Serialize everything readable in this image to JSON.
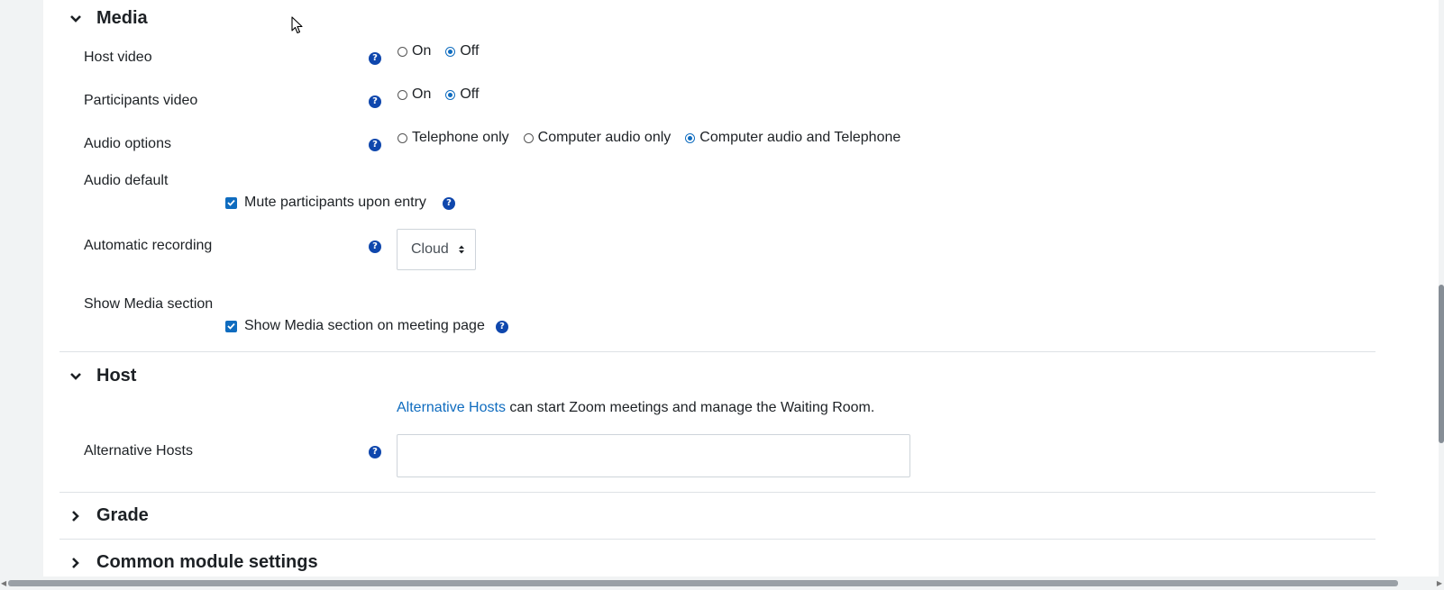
{
  "media": {
    "title": "Media",
    "host_video": {
      "label": "Host video",
      "options": [
        "On",
        "Off"
      ],
      "selected": "Off"
    },
    "participants_video": {
      "label": "Participants video",
      "options": [
        "On",
        "Off"
      ],
      "selected": "Off"
    },
    "audio_options": {
      "label": "Audio options",
      "options": [
        "Telephone only",
        "Computer audio only",
        "Computer audio and Telephone"
      ],
      "selected": "Computer audio and Telephone"
    },
    "audio_default": {
      "label": "Audio default",
      "checkbox_label": "Mute participants upon entry",
      "checked": true
    },
    "automatic_recording": {
      "label": "Automatic recording",
      "value": "Cloud"
    },
    "show_media": {
      "label": "Show Media section",
      "checkbox_label": "Show Media section on meeting page",
      "checked": true
    }
  },
  "host": {
    "title": "Host",
    "info_link": "Alternative Hosts",
    "info_text": " can start Zoom meetings and manage the Waiting Room.",
    "alternative_hosts": {
      "label": "Alternative Hosts",
      "value": ""
    }
  },
  "grade": {
    "title": "Grade"
  },
  "common": {
    "title": "Common module settings"
  },
  "icons": {
    "help": "question-circle-icon",
    "expanded": "chevron-down-icon",
    "collapsed": "chevron-right-icon"
  },
  "colors": {
    "accent": "#0f6cbf",
    "help": "#0f47ad"
  }
}
